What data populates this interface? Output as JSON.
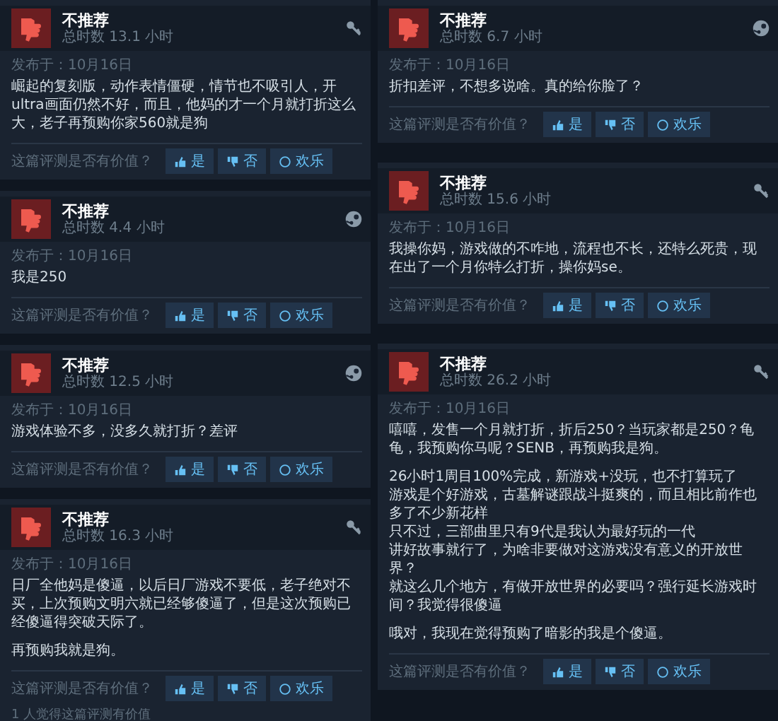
{
  "columns": [
    {
      "reviews": [
        {
          "verdict": "不推荐",
          "hours": "总时数 13.1 小时",
          "kind": "key",
          "date": "发布于：10月16日",
          "body": [
            [
              "崛起的复刻版，动作表情僵硬，情节也不吸引人，开ultra画面仍然不好，而且，他妈的才一个月就打折这么大，老子再预购你家560就是狗"
            ]
          ],
          "question": "这篇评测是否有价值？",
          "votes": [
            "是",
            "否",
            "欢乐"
          ]
        },
        {
          "verdict": "不推荐",
          "hours": "总时数 4.4 小时",
          "kind": "steam",
          "date": "发布于：10月16日",
          "body": [
            [
              "我是250"
            ]
          ],
          "question": "这篇评测是否有价值？",
          "votes": [
            "是",
            "否",
            "欢乐"
          ]
        },
        {
          "verdict": "不推荐",
          "hours": "总时数 12.5 小时",
          "kind": "steam",
          "date": "发布于：10月16日",
          "body": [
            [
              "游戏体验不多，没多久就打折？差评"
            ]
          ],
          "question": "这篇评测是否有价值？",
          "votes": [
            "是",
            "否",
            "欢乐"
          ]
        },
        {
          "verdict": "不推荐",
          "hours": "总时数 16.3 小时",
          "kind": "key",
          "date": "发布于：10月16日",
          "body": [
            [
              "日厂全他妈是傻逼，以后日厂游戏不要低，老子绝对不买，上次预购文明六就已经够傻逼了，但是这次预购已经傻逼得突破天际了。"
            ],
            [
              "再预购我就是狗。"
            ]
          ],
          "question": "这篇评测是否有价值？",
          "votes": [
            "是",
            "否",
            "欢乐"
          ],
          "helpful": "1 人觉得这篇评测有价值"
        }
      ]
    },
    {
      "reviews": [
        {
          "verdict": "不推荐",
          "hours": "总时数 6.7 小时",
          "kind": "steam",
          "date": "发布于：10月16日",
          "body": [
            [
              "折扣差评，不想多说啥。真的给你脸了？"
            ]
          ],
          "question": "这篇评测是否有价值？",
          "votes": [
            "是",
            "否",
            "欢乐"
          ]
        },
        {
          "verdict": "不推荐",
          "hours": "总时数 15.6 小时",
          "kind": "key",
          "date": "发布于：10月16日",
          "body": [
            [
              "我操你妈，游戏做的不咋地，流程也不长，还特么死贵，现在出了一个月你特么打折，操你妈se。"
            ]
          ],
          "question": "这篇评测是否有价值？",
          "votes": [
            "是",
            "否",
            "欢乐"
          ]
        },
        {
          "verdict": "不推荐",
          "hours": "总时数 26.2 小时",
          "kind": "key",
          "date": "发布于：10月16日",
          "body": [
            [
              "嘻嘻，发售一个月就打折，折后250？当玩家都是250？龟龟，我预购你马呢？SENB，再预购我是狗。"
            ],
            [
              "26小时1周目100%完成，新游戏+没玩，也不打算玩了",
              "游戏是个好游戏，古墓解谜跟战斗挺爽的，而且相比前作也多了不少新花样",
              "只不过，三部曲里只有9代是我认为最好玩的一代",
              "讲好故事就行了，为啥非要做对这游戏没有意义的开放世界？",
              "就这么几个地方，有做开放世界的必要吗？强行延长游戏时间？我觉得很傻逼"
            ],
            [
              "哦对，我现在觉得预购了暗影的我是个傻逼。"
            ]
          ],
          "question": "这篇评测是否有价值？",
          "votes": [
            "是",
            "否",
            "欢乐"
          ]
        }
      ]
    }
  ]
}
